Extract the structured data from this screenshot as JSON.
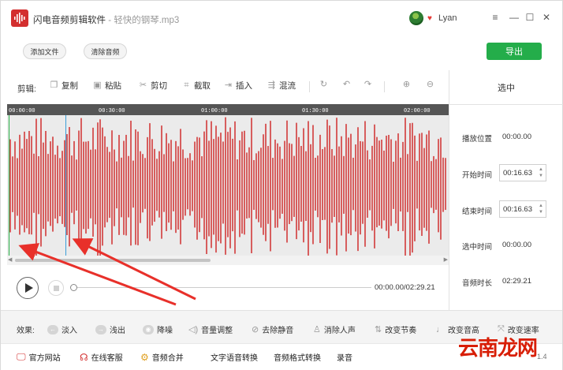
{
  "window": {
    "app_name": "闪电音频剪辑软件",
    "separator": " - ",
    "file_name": "轻快的钢琴.mp3",
    "user": "Lyan",
    "vip_icon": "heart-icon",
    "controls": [
      "≡",
      "—",
      "☐",
      "✕"
    ]
  },
  "toolbar": {
    "add_file": "添加文件",
    "clear_audio": "清除音频",
    "export": "导出",
    "export_color": "#24AD4A"
  },
  "edit_bar": {
    "label": "剪辑:",
    "tools": [
      {
        "label": "复制",
        "icon": "copy-icon"
      },
      {
        "label": "粘贴",
        "icon": "paste-icon"
      },
      {
        "label": "剪切",
        "icon": "scissors-icon"
      },
      {
        "label": "截取",
        "icon": "crop-icon"
      },
      {
        "label": "插入",
        "icon": "insert-icon"
      },
      {
        "label": "混流",
        "icon": "mix-icon"
      }
    ],
    "icon_tools": [
      "undo-arc-icon",
      "undo-icon",
      "redo-icon",
      "zoom-in-icon",
      "zoom-out-icon"
    ]
  },
  "waveform": {
    "ruler": [
      "00:00:00",
      "00:30:00",
      "01:00:00",
      "01:30:00",
      "02:00:00"
    ],
    "wave_color": "#D23A3A"
  },
  "panel": {
    "title": "选中",
    "play_position_label": "播放位置",
    "play_position": "00:00.00",
    "start_label": "开始时间",
    "start_value": "00:16.63",
    "end_label": "结束时间",
    "end_value": "00:16.63",
    "selected_label": "选中时间",
    "selected_value": "00:00.00",
    "duration_label": "音频时长",
    "duration_value": "02:29.21"
  },
  "player": {
    "time": "00:00.00/02:29.21"
  },
  "effects": {
    "label": "效果:",
    "items": [
      "淡入",
      "浅出",
      "降噪",
      "音量调整",
      "去除静音",
      "消除人声",
      "改变节奏",
      "改变音高",
      "改变速率"
    ]
  },
  "bottom": {
    "website": "官方网站",
    "service": "在线客服",
    "merge": "音频合并",
    "tts": "文字语音转换",
    "format": "音频格式转换",
    "record": "录音",
    "version": "1.4"
  },
  "watermark": {
    "part1": "云南",
    "part2": "龙网"
  }
}
